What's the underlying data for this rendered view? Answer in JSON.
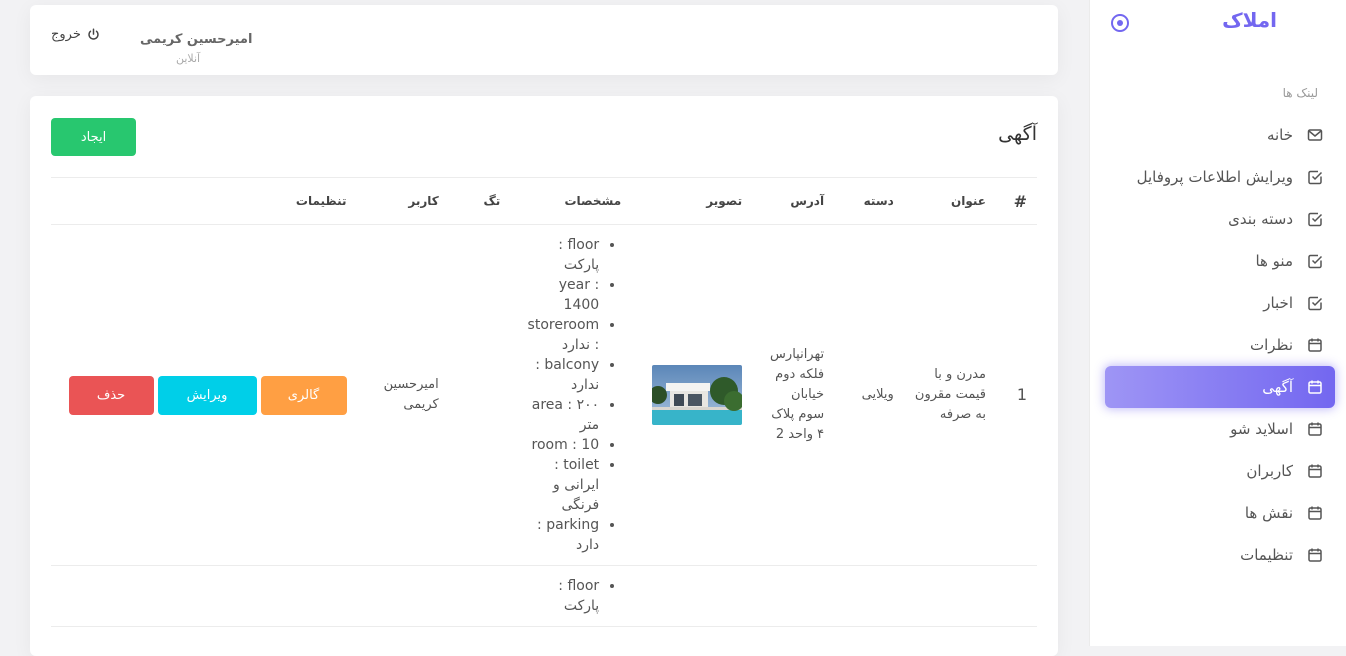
{
  "sidebar": {
    "brand": "املاک",
    "section_title": "لینک ها",
    "items": [
      {
        "label": "خانه",
        "icon": "mail-icon"
      },
      {
        "label": "ویرایش اطلاعات پروفایل",
        "icon": "check-square-icon"
      },
      {
        "label": "دسته بندی",
        "icon": "check-square-icon"
      },
      {
        "label": "منو ها",
        "icon": "check-square-icon"
      },
      {
        "label": "اخبار",
        "icon": "check-square-icon"
      },
      {
        "label": "نظرات",
        "icon": "calendar-icon"
      },
      {
        "label": "آگهی",
        "icon": "calendar-icon",
        "active": true
      },
      {
        "label": "اسلاید شو",
        "icon": "calendar-icon"
      },
      {
        "label": "کاربران",
        "icon": "calendar-icon"
      },
      {
        "label": "نقش ها",
        "icon": "calendar-icon"
      },
      {
        "label": "تنظیمات",
        "icon": "calendar-icon"
      }
    ]
  },
  "navbar": {
    "user_name": "امیرحسین کریمی",
    "user_status": "آنلاین",
    "logout_label": "خروج"
  },
  "card": {
    "title": "آگهی",
    "create_label": "ایجاد"
  },
  "table": {
    "headers": [
      "#",
      "عنوان",
      "دسته",
      "آدرس",
      "تصویر",
      "مشخصات",
      "تگ",
      "کاربر",
      "تنظیمات"
    ],
    "rows": [
      {
        "num": "1",
        "title": "مدرن و با قیمت مقرون به صرفه",
        "category": "ویلایی",
        "address": "تهرانپارس فلکه دوم خیابان سوم پلاک ۴ واحد 2",
        "specs": [
          "floor : پارکت",
          "year : 1400",
          "storeroom : ندارد",
          "balcony : ندارد",
          "area : ۲۰۰ متر",
          "room : 10",
          "toilet : ایرانی و فرنگی",
          "parking : دارد"
        ],
        "tag": "",
        "user": "امیرحسین کریمی",
        "gallery_label": "گالری",
        "edit_label": "ویرایش",
        "delete_label": "حذف"
      },
      {
        "specs": [
          "floor : پارکت"
        ]
      }
    ]
  },
  "colors": {
    "primary": "#7367f0",
    "success": "#28c76f",
    "warning": "#ff9f43",
    "info": "#00cfe8",
    "danger": "#ea5455"
  }
}
